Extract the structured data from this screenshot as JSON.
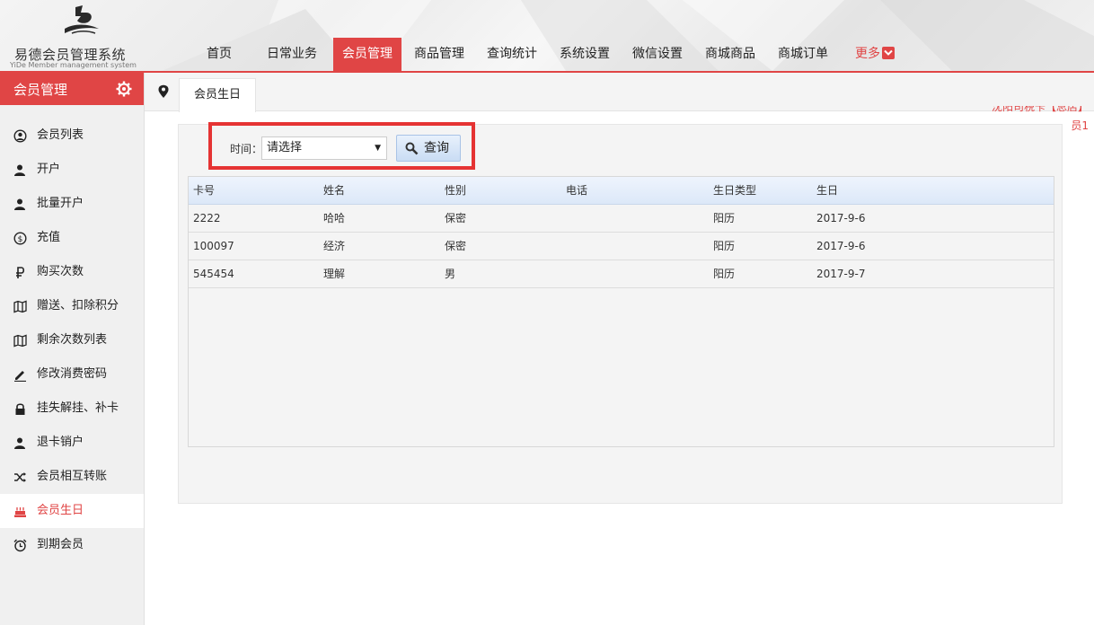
{
  "header": {
    "logo_cn": "易德会员管理系统",
    "logo_en": "YiDe Member management system",
    "nav": [
      {
        "label": "首页",
        "active": false
      },
      {
        "label": "日常业务",
        "active": false
      },
      {
        "label": "会员管理",
        "active": true
      },
      {
        "label": "商品管理",
        "active": false
      },
      {
        "label": "查询统计",
        "active": false
      },
      {
        "label": "系统设置",
        "active": false
      },
      {
        "label": "微信设置",
        "active": false
      },
      {
        "label": "商城商品",
        "active": false
      },
      {
        "label": "商城订单",
        "active": false
      },
      {
        "label": "更多",
        "active": false
      }
    ]
  },
  "sidebar": {
    "title": "会员管理",
    "items": [
      {
        "label": "会员列表",
        "icon": "user-circle-icon"
      },
      {
        "label": "开户",
        "icon": "user-icon"
      },
      {
        "label": "批量开户",
        "icon": "user-icon"
      },
      {
        "label": "充值",
        "icon": "coin-icon"
      },
      {
        "label": "购买次数",
        "icon": "ruble-icon"
      },
      {
        "label": "赠送、扣除积分",
        "icon": "map-icon"
      },
      {
        "label": "剩余次数列表",
        "icon": "map-icon"
      },
      {
        "label": "修改消费密码",
        "icon": "pencil-icon"
      },
      {
        "label": "挂失解挂、补卡",
        "icon": "lock-icon"
      },
      {
        "label": "退卡销户",
        "icon": "user-icon"
      },
      {
        "label": "会员相互转账",
        "icon": "shuffle-icon"
      },
      {
        "label": "会员生日",
        "icon": "cake-icon",
        "active": true
      },
      {
        "label": "到期会员",
        "icon": "alarm-clock-icon"
      }
    ]
  },
  "tabs": [
    {
      "label": "会员生日"
    }
  ],
  "marquee": [
    "沈阳司税卡【总店】",
    "员1"
  ],
  "filter": {
    "label": "时间：",
    "select_value": "请选择",
    "query_label": "查询"
  },
  "table": {
    "columns": [
      "卡号",
      "姓名",
      "性别",
      "电话",
      "生日类型",
      "生日"
    ],
    "rows": [
      [
        "2222",
        "哈哈",
        "保密",
        "",
        "阳历",
        "2017-9-6"
      ],
      [
        "100097",
        "经济",
        "保密",
        "",
        "阳历",
        "2017-9-6"
      ],
      [
        "545454",
        "理解",
        "男",
        "",
        "阳历",
        "2017-9-7"
      ]
    ]
  },
  "colors": {
    "accent": "#e04545",
    "highlight_box": "#e53333",
    "table_header": "#dce8f8"
  }
}
